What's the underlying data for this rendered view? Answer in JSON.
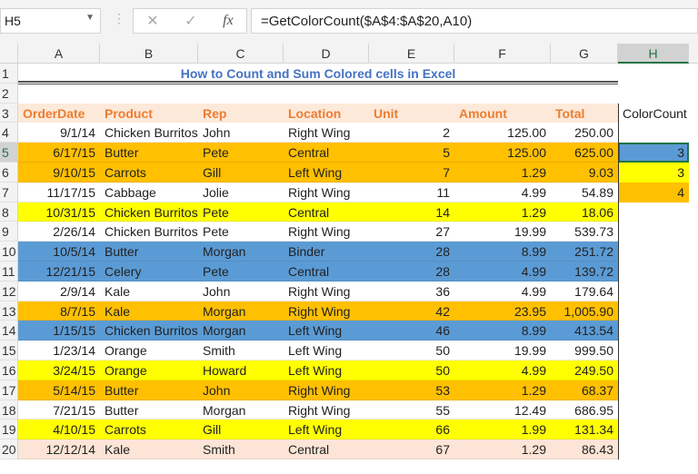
{
  "formula_bar": {
    "name_box": "H5",
    "cancel_icon": "✕",
    "enter_icon": "✓",
    "fx_label": "fx",
    "formula": "=GetColorCount($A$4:$A$20,A10)"
  },
  "columns": [
    "A",
    "B",
    "C",
    "D",
    "E",
    "F",
    "G",
    "H"
  ],
  "selected_column": "H",
  "title": "How to Count and Sum Colored cells in Excel",
  "headers": [
    "OrderDate",
    "Product",
    "Rep",
    "Location",
    "Unit",
    "Amount",
    "Total"
  ],
  "side_header": "ColorCount",
  "colors": {
    "orange": "#FFC000",
    "yellow": "#FFFF00",
    "blue": "#5B9BD5",
    "pink": "#FCE4D6",
    "white": "#FFFFFF",
    "header_bg": "#FDE9D9",
    "header_text": "#ED7D31",
    "title": "#4472C4"
  },
  "rows": [
    {
      "n": "4",
      "fill": "white",
      "cells": [
        "9/1/14",
        "Chicken Burritos",
        "John",
        "Right Wing",
        "2",
        "125.00",
        "250.00"
      ]
    },
    {
      "n": "5",
      "fill": "orange",
      "cells": [
        "6/17/15",
        "Butter",
        "Pete",
        "Central",
        "5",
        "125.00",
        "625.00"
      ]
    },
    {
      "n": "6",
      "fill": "orange",
      "cells": [
        "9/10/15",
        "Carrots",
        "Gill",
        "Left Wing",
        "7",
        "1.29",
        "9.03"
      ]
    },
    {
      "n": "7",
      "fill": "white",
      "cells": [
        "11/17/15",
        "Cabbage",
        "Jolie",
        "Right Wing",
        "11",
        "4.99",
        "54.89"
      ]
    },
    {
      "n": "8",
      "fill": "yellow",
      "cells": [
        "10/31/15",
        "Chicken Burritos",
        "Pete",
        "Central",
        "14",
        "1.29",
        "18.06"
      ]
    },
    {
      "n": "9",
      "fill": "white",
      "cells": [
        "2/26/14",
        "Chicken Burritos",
        "Pete",
        "Right Wing",
        "27",
        "19.99",
        "539.73"
      ]
    },
    {
      "n": "10",
      "fill": "blue",
      "cells": [
        "10/5/14",
        "Butter",
        "Morgan",
        "Binder",
        "28",
        "8.99",
        "251.72"
      ]
    },
    {
      "n": "11",
      "fill": "blue",
      "cells": [
        "12/21/15",
        "Celery",
        "Pete",
        "Central",
        "28",
        "4.99",
        "139.72"
      ]
    },
    {
      "n": "12",
      "fill": "white",
      "cells": [
        "2/9/14",
        "Kale",
        "John",
        "Right Wing",
        "36",
        "4.99",
        "179.64"
      ]
    },
    {
      "n": "13",
      "fill": "orange",
      "cells": [
        "8/7/15",
        "Kale",
        "Morgan",
        "Right Wing",
        "42",
        "23.95",
        "1,005.90"
      ]
    },
    {
      "n": "14",
      "fill": "blue",
      "cells": [
        "1/15/15",
        "Chicken Burritos",
        "Morgan",
        "Left Wing",
        "46",
        "8.99",
        "413.54"
      ]
    },
    {
      "n": "15",
      "fill": "white",
      "cells": [
        "1/23/14",
        "Orange",
        "Smith",
        "Left Wing",
        "50",
        "19.99",
        "999.50"
      ]
    },
    {
      "n": "16",
      "fill": "yellow",
      "cells": [
        "3/24/15",
        "Orange",
        "Howard",
        "Left Wing",
        "50",
        "4.99",
        "249.50"
      ]
    },
    {
      "n": "17",
      "fill": "orange",
      "cells": [
        "5/14/15",
        "Butter",
        "John",
        "Right Wing",
        "53",
        "1.29",
        "68.37"
      ]
    },
    {
      "n": "18",
      "fill": "white",
      "cells": [
        "7/21/15",
        "Butter",
        "Morgan",
        "Right Wing",
        "55",
        "12.49",
        "686.95"
      ]
    },
    {
      "n": "19",
      "fill": "yellow",
      "cells": [
        "4/10/15",
        "Carrots",
        "Gill",
        "Left Wing",
        "66",
        "1.99",
        "131.34"
      ]
    },
    {
      "n": "20",
      "fill": "pink",
      "cells": [
        "12/12/14",
        "Kale",
        "Smith",
        "Central",
        "67",
        "1.29",
        "86.43"
      ]
    }
  ],
  "color_counts": [
    {
      "row": "5",
      "fill": "blue",
      "value": "3"
    },
    {
      "row": "6",
      "fill": "yellow",
      "value": "3"
    },
    {
      "row": "7",
      "fill": "orange",
      "value": "4"
    }
  ]
}
